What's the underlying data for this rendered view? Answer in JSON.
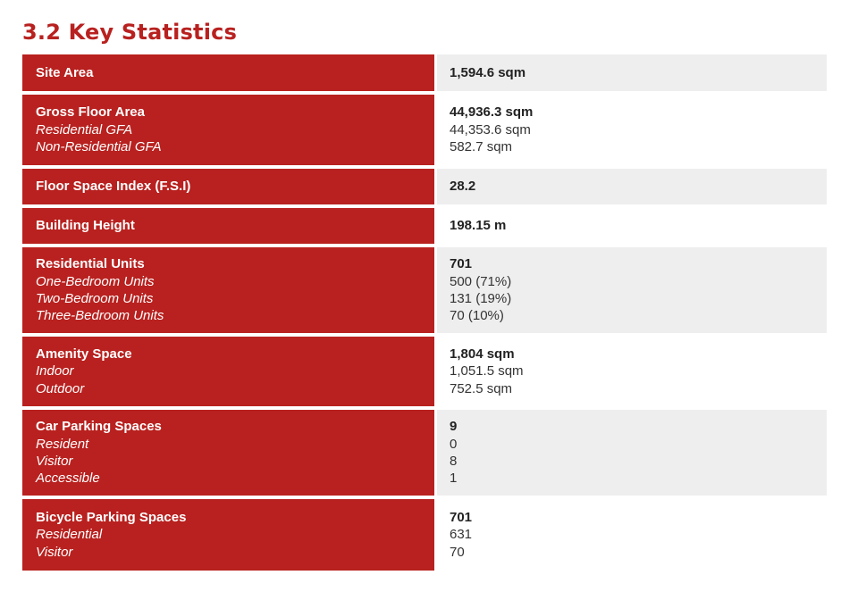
{
  "title": "3.2 Key Statistics",
  "rows": [
    {
      "label": "Site Area",
      "value": "1,594.6 sqm",
      "sub_labels": [],
      "sub_values": []
    },
    {
      "label": "Gross Floor Area",
      "value": "44,936.3 sqm",
      "sub_labels": [
        "Residential GFA",
        "Non-Residential GFA"
      ],
      "sub_values": [
        "44,353.6 sqm",
        "582.7 sqm"
      ]
    },
    {
      "label": "Floor Space Index (F.S.I)",
      "value": "28.2",
      "sub_labels": [],
      "sub_values": []
    },
    {
      "label": "Building Height",
      "value": "198.15 m",
      "sub_labels": [],
      "sub_values": []
    },
    {
      "label": "Residential Units",
      "value": "701",
      "sub_labels": [
        "One-Bedroom Units",
        "Two-Bedroom Units",
        "Three-Bedroom Units"
      ],
      "sub_values": [
        "500 (71%)",
        "131 (19%)",
        "70 (10%)"
      ]
    },
    {
      "label": "Amenity Space",
      "value": "1,804 sqm",
      "sub_labels": [
        "Indoor",
        "Outdoor"
      ],
      "sub_values": [
        "1,051.5 sqm",
        "752.5 sqm"
      ]
    },
    {
      "label": "Car Parking Spaces",
      "value": "9",
      "sub_labels": [
        "Resident",
        "Visitor",
        "Accessible"
      ],
      "sub_values": [
        "0",
        "8",
        "1"
      ]
    },
    {
      "label": "Bicycle Parking Spaces",
      "value": "701",
      "sub_labels": [
        "Residential",
        "Visitor"
      ],
      "sub_values": [
        "631",
        "70"
      ]
    }
  ],
  "colors": {
    "accent": "#b8211f",
    "row_shade": "#eeeeee",
    "text_dark": "#222222"
  }
}
